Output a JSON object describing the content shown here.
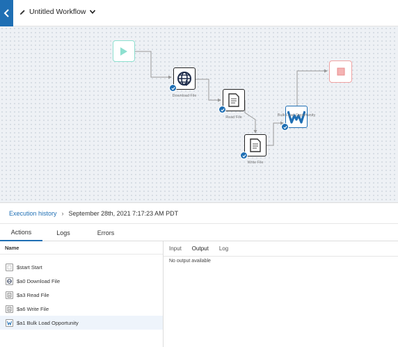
{
  "header": {
    "title": "Untitled Workflow"
  },
  "canvas": {
    "nodes": {
      "download_file": "Download File",
      "read_file": "Read File",
      "bulk_load": "Bulk Load Opportunity",
      "write_file": "Write File"
    }
  },
  "breadcrumb": {
    "link": "Execution history",
    "separator": "›",
    "current": "September 28th, 2021 7:17:23 AM PDT"
  },
  "tabs": {
    "actions": "Actions",
    "logs": "Logs",
    "errors": "Errors"
  },
  "actions_list": {
    "column_header": "Name",
    "items": [
      {
        "label": "$start Start",
        "icon": "start-icon"
      },
      {
        "label": "$a0 Download File",
        "icon": "globe-icon"
      },
      {
        "label": "$a3 Read File",
        "icon": "document-icon"
      },
      {
        "label": "$a6 Write File",
        "icon": "document-icon"
      },
      {
        "label": "$a1 Bulk Load Opportunity",
        "icon": "w-logo-icon"
      }
    ]
  },
  "output": {
    "tabs": {
      "input": "Input",
      "output": "Output",
      "log": "Log"
    },
    "message": "No output available"
  },
  "colors": {
    "accent": "#1f6fb4",
    "start": "#8ee0d0",
    "end": "#f0a3a3"
  }
}
